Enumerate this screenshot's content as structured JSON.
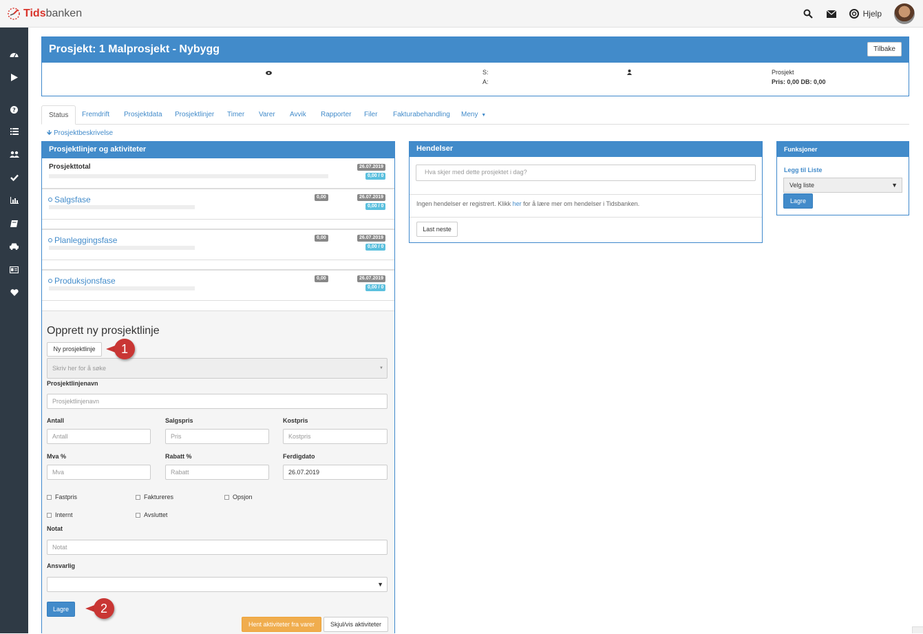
{
  "app": {
    "logo_part1": "Tids",
    "logo_part2": "banken",
    "help_label": "Hjelp"
  },
  "sidebar": {
    "icons": [
      "dashboard-icon",
      "play-icon",
      "question-icon",
      "list-icon",
      "users-icon",
      "check-icon",
      "bar-chart-icon",
      "book-icon",
      "car-icon",
      "id-card-icon",
      "heart-icon"
    ]
  },
  "project": {
    "title": "Prosjekt: 1 Malprosjekt - Nybygg",
    "back_label": "Tilbake",
    "s_label": "S:",
    "a_label": "A:",
    "type_label": "Prosjekt",
    "price_summary": "Pris: 0,00 DB: 0,00"
  },
  "tabs": [
    "Status",
    "Fremdrift",
    "Prosjektdata",
    "Prosjektlinjer",
    "Timer",
    "Varer",
    "Avvik",
    "Rapporter",
    "Filer",
    "Fakturabehandling",
    "Meny"
  ],
  "description_link": "Prosjektbeskrivelse",
  "lines_panel": {
    "title": "Prosjektlinjer og aktiviteter",
    "total_label": "Prosjekttotal",
    "total_date": "26.07.2019",
    "total_value": "0,00 / 0",
    "phases": [
      {
        "name": "Salgsfase",
        "amount": "0,00",
        "date": "26.07.2019",
        "value": "0,00 / 0"
      },
      {
        "name": "Planleggingsfase",
        "amount": "0,00",
        "date": "26.07.2019",
        "value": "0,00 / 0"
      },
      {
        "name": "Produksjonsfase",
        "amount": "0,00",
        "date": "26.07.2019",
        "value": "0,00 / 0"
      }
    ]
  },
  "create_form": {
    "heading": "Opprett ny prosjektlinje",
    "new_line_button": "Ny prosjektlinje",
    "search_placeholder": "Skriv her for å søke",
    "name_label": "Prosjektlinjenavn",
    "name_placeholder": "Prosjektlinjenavn",
    "antall_label": "Antall",
    "antall_placeholder": "Antall",
    "salgspris_label": "Salgspris",
    "salgspris_placeholder": "Pris",
    "kostpris_label": "Kostpris",
    "kostpris_placeholder": "Kostpris",
    "mva_label": "Mva %",
    "mva_placeholder": "Mva",
    "rabatt_label": "Rabatt %",
    "rabatt_placeholder": "Rabatt",
    "ferdigdato_label": "Ferdigdato",
    "ferdigdato_value": "26.07.2019",
    "checkboxes": [
      "Fastpris",
      "Faktureres",
      "Opsjon",
      "Internt",
      "Avsluttet"
    ],
    "notat_label": "Notat",
    "notat_placeholder": "Notat",
    "ansvarlig_label": "Ansvarlig",
    "save_button": "Lagre",
    "fetch_button": "Hent aktiviteter fra varer",
    "toggle_button": "Skjul/vis aktiviteter"
  },
  "callouts": [
    "1",
    "2"
  ],
  "events_panel": {
    "title": "Hendelser",
    "input_placeholder": "Hva skjer med dette prosjektet i dag?",
    "empty_text_before": "Ingen hendelser er registrert. Klikk ",
    "empty_link": "her",
    "empty_text_after": " for å lære mer om hendelser i Tidsbanken.",
    "load_more_button": "Last neste"
  },
  "functions_panel": {
    "title": "Funksjoner",
    "add_to_list_link": "Legg til Liste",
    "select_value": "Velg liste",
    "save_button": "Lagre"
  },
  "colors": {
    "primary": "#428bca",
    "sidebar": "#2f3a45",
    "callout": "#c93634",
    "warning": "#f0ad4e",
    "badge_gray": "#888888",
    "badge_blue": "#5bc0de"
  }
}
